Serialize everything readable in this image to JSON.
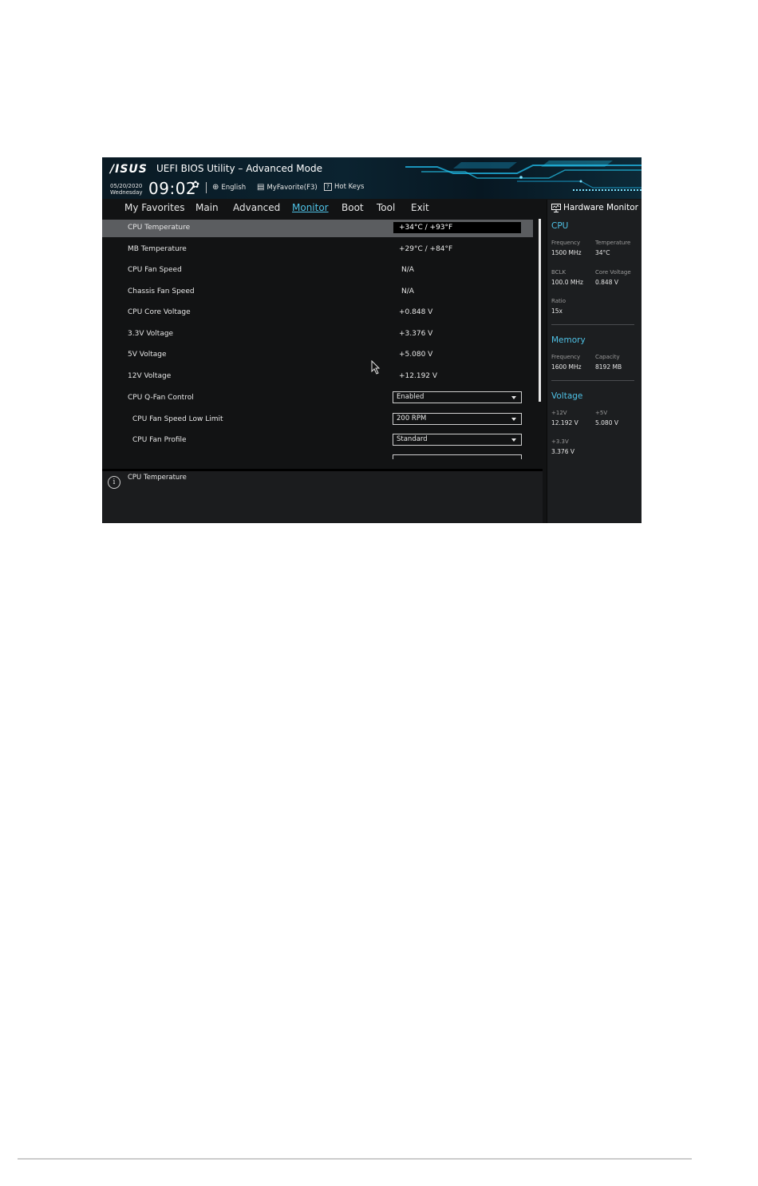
{
  "header": {
    "logo": "/ISUS",
    "title": "UEFI BIOS Utility – Advanced Mode",
    "date": "05/20/2020",
    "weekday": "Wednesday",
    "time": "09:02",
    "toolbar": [
      {
        "label": "English",
        "icon": "globe-icon"
      },
      {
        "label": "MyFavorite(F3)",
        "icon": "favorite-list-icon"
      },
      {
        "label": "Hot Keys",
        "icon": "question-box-icon"
      }
    ]
  },
  "nav": {
    "tabs": [
      "My Favorites",
      "Main",
      "Advanced",
      "Monitor",
      "Boot",
      "Tool",
      "Exit"
    ],
    "active": "Monitor"
  },
  "items": [
    {
      "label": "CPU Temperature",
      "value": "+34°C / +93°F"
    },
    {
      "label": "MB Temperature",
      "value": "+29°C / +84°F"
    },
    {
      "label": "CPU Fan Speed",
      "value": "N/A"
    },
    {
      "label": "Chassis Fan Speed",
      "value": "N/A"
    },
    {
      "label": "CPU Core Voltage",
      "value": "+0.848 V"
    },
    {
      "label": "3.3V Voltage",
      "value": "+3.376 V"
    },
    {
      "label": "5V Voltage",
      "value": "+5.080 V"
    },
    {
      "label": "12V Voltage",
      "value": "+12.192 V"
    },
    {
      "label": "CPU Q-Fan Control",
      "value": "Enabled"
    },
    {
      "label": "CPU Fan Speed Low Limit",
      "value": "200 RPM"
    },
    {
      "label": "CPU Fan Profile",
      "value": "Standard"
    }
  ],
  "help": {
    "text": "CPU Temperature"
  },
  "hw_monitor": {
    "title": "Hardware Monitor",
    "cpu": {
      "heading": "CPU",
      "frequency_label": "Frequency",
      "frequency": "1500 MHz",
      "temperature_label": "Temperature",
      "temperature": "34°C",
      "bclk_label": "BCLK",
      "bclk": "100.0 MHz",
      "core_voltage_label": "Core Voltage",
      "core_voltage": "0.848 V",
      "ratio_label": "Ratio",
      "ratio": "15x"
    },
    "memory": {
      "heading": "Memory",
      "frequency_label": "Frequency",
      "frequency": "1600 MHz",
      "capacity_label": "Capacity",
      "capacity": "8192 MB"
    },
    "voltage": {
      "heading": "Voltage",
      "v12_label": "+12V",
      "v12": "12.192 V",
      "v5_label": "+5V",
      "v5": "5.080 V",
      "v33_label": "+3.3V",
      "v33": "3.376 V"
    }
  },
  "colors": {
    "accent": "#4fc2e6",
    "background": "#121314",
    "selected_row": "#5b5d60",
    "panel": "#1c1e20"
  }
}
